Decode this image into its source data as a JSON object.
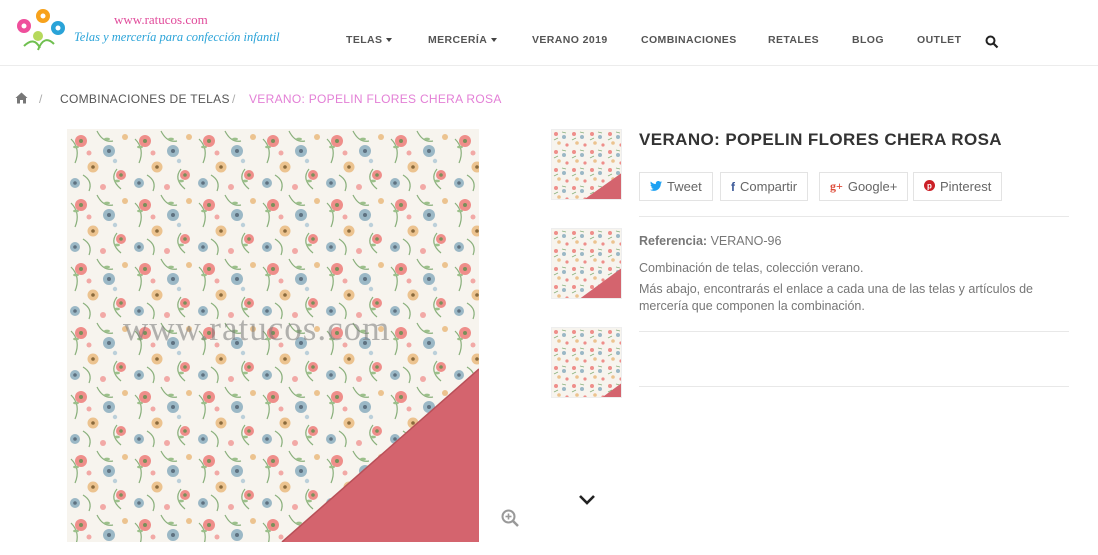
{
  "logo": {
    "url_text": "www.ratucos.com",
    "tagline": "Telas y mercería para confección infantil"
  },
  "nav": {
    "items": [
      {
        "label": "TELAS",
        "has_dropdown": true
      },
      {
        "label": "MERCERÍA",
        "has_dropdown": true
      },
      {
        "label": "VERANO 2019",
        "has_dropdown": false
      },
      {
        "label": "COMBINACIONES",
        "has_dropdown": false
      },
      {
        "label": "RETALES",
        "has_dropdown": false
      },
      {
        "label": "BLOG",
        "has_dropdown": false
      },
      {
        "label": "OUTLET",
        "has_dropdown": false
      }
    ],
    "search_icon": "search-icon"
  },
  "breadcrumb": {
    "home_icon": "home-icon",
    "separator": "/",
    "category": "COMBINACIONES DE TELAS",
    "current": "VERANO: POPELIN FLORES CHERA ROSA"
  },
  "gallery": {
    "watermark": "www.ratucos.com",
    "zoom_icon": "zoom-in-icon",
    "thumbnails_count": 3,
    "next_icon": "chevron-down-icon"
  },
  "product": {
    "title": "VERANO: POPELIN FLORES CHERA ROSA",
    "share": [
      {
        "label": "Tweet",
        "icon": "twitter-icon",
        "color": "#1da1f2"
      },
      {
        "label": "Compartir",
        "icon": "facebook-icon",
        "color": "#3b5998"
      },
      {
        "label": "Google+",
        "icon": "google-plus-icon",
        "color": "#dd4b39"
      },
      {
        "label": "Pinterest",
        "icon": "pinterest-icon",
        "color": "#cb2027"
      }
    ],
    "reference_label": "Referencia:",
    "reference_value": "VERANO-96",
    "description_1": "Combinación de telas, colección verano.",
    "description_2": "Más abajo, encontrarás el enlace a cada una de las telas y artículos de mercería que componen la combinación."
  },
  "colors": {
    "accent_pink": "#e37fd6",
    "logo_pink": "#e14b9b",
    "logo_blue": "#2aa3d8",
    "fabric_band": "#d4646e"
  }
}
